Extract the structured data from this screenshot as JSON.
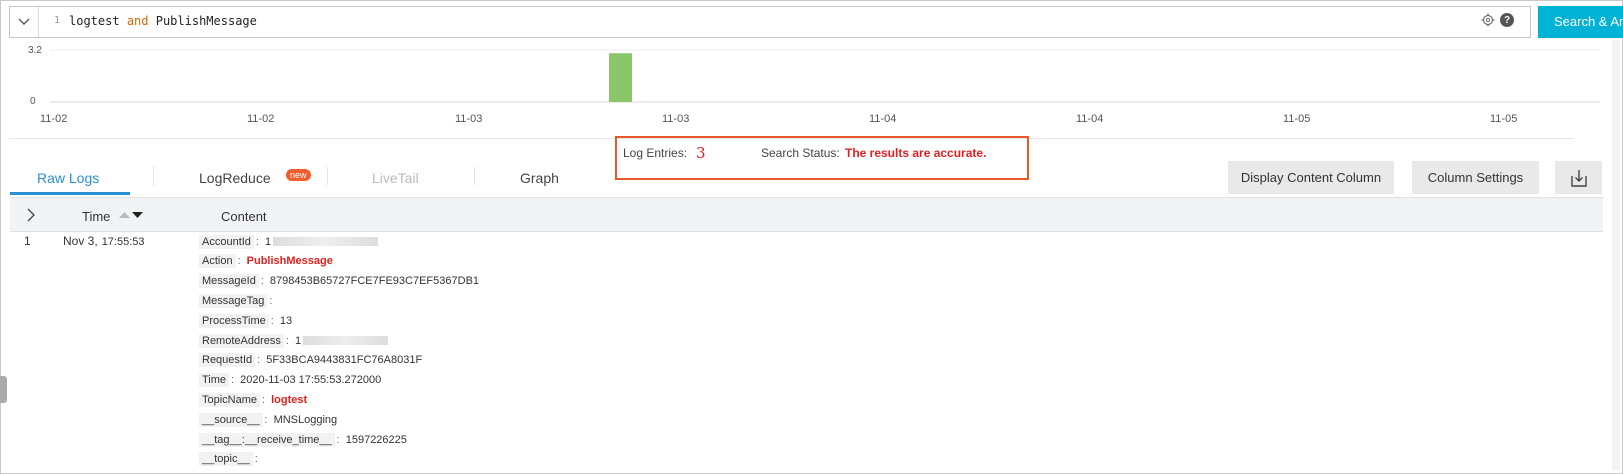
{
  "query": {
    "line_number": "1",
    "text_pre": "logtest",
    "keyword": "and",
    "text_post": "PublishMessage"
  },
  "search_button_label": "Search & Analyze",
  "histogram": {
    "type": "bar",
    "y_ticks": [
      "3.2",
      "0"
    ],
    "x_ticks": [
      "11-02",
      "11-02",
      "11-03",
      "11-03",
      "11-04",
      "11-04",
      "11-05",
      "11-05"
    ],
    "ylim": [
      0,
      3.2
    ],
    "bars": [
      {
        "position": "11-03 (between 2nd and 3rd tick pair)",
        "value": 3
      }
    ],
    "bar_color": "#8cc66b"
  },
  "status": {
    "log_entries_label": "Log Entries:",
    "log_entries_value": "3",
    "search_status_label": "Search Status:",
    "search_status_value": "The results are accurate."
  },
  "tabs": [
    {
      "label": "Raw Logs",
      "active": true
    },
    {
      "label": "LogReduce",
      "badge": "new"
    },
    {
      "label": "LiveTail",
      "disabled": true
    },
    {
      "label": "Graph"
    }
  ],
  "buttons": {
    "display_content_column": "Display Content Column",
    "column_settings": "Column Settings"
  },
  "table": {
    "headers": {
      "time": "Time",
      "content": "Content"
    },
    "row": {
      "number": "1",
      "date": "Nov 3,",
      "time": "17:55:53"
    },
    "fields": [
      {
        "key": "AccountId",
        "value": "1",
        "blurred": true
      },
      {
        "key": "Action",
        "value": "PublishMessage",
        "highlight": true
      },
      {
        "key": "MessageId",
        "value": "8798453B65727FCE7FE93C7EF5367DB1"
      },
      {
        "key": "MessageTag",
        "value": ""
      },
      {
        "key": "ProcessTime",
        "value": "13"
      },
      {
        "key": "RemoteAddress",
        "value": "1",
        "blurred": true
      },
      {
        "key": "RequestId",
        "value": "5F33BCA9443831FC76A8031F"
      },
      {
        "key": "Time",
        "value": "2020-11-03 17:55:53.272000"
      },
      {
        "key": "TopicName",
        "value": "logtest",
        "highlight": true
      },
      {
        "key": "__source__",
        "value": "MNSLogging"
      },
      {
        "key": "__tag__:__receive_time__",
        "value": "1597226225"
      },
      {
        "key": "__topic__",
        "value": ""
      }
    ]
  },
  "colors": {
    "accent": "#2a8fd6",
    "search_button": "#00b3d6",
    "highlight_red": "#e02020",
    "status_box_border": "#e8582c"
  }
}
